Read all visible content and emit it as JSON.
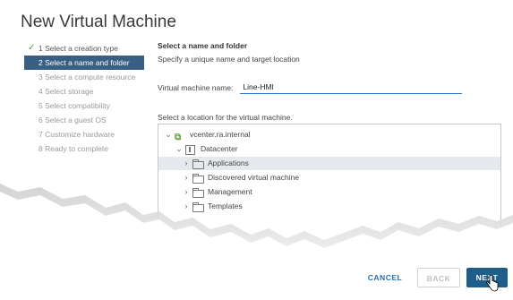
{
  "window": {
    "title": "New Virtual Machine"
  },
  "steps": [
    {
      "label": "1 Select a creation type",
      "state": "done"
    },
    {
      "label": "2 Select a name and folder",
      "state": "active"
    },
    {
      "label": "3 Select a compute resource",
      "state": "pending"
    },
    {
      "label": "4 Select storage",
      "state": "pending"
    },
    {
      "label": "5 Select compatibility",
      "state": "pending"
    },
    {
      "label": "6 Select a guest OS",
      "state": "pending"
    },
    {
      "label": "7 Customize hardware",
      "state": "pending"
    },
    {
      "label": "8 Ready to complete",
      "state": "pending"
    }
  ],
  "main": {
    "section_title": "Select a name and folder",
    "section_subtitle": "Specify a unique name and target location",
    "vm_name_label": "Virtual machine name:",
    "vm_name_value": "Line-HMI",
    "location_label": "Select a location for the virtual machine."
  },
  "tree": {
    "root": "vcenter.ra.internal",
    "datacenter": "Datacenter",
    "folders": [
      "Applications",
      "Discovered virtual machine",
      "Management",
      "Templates"
    ],
    "selected": "Applications"
  },
  "footer": {
    "cancel_label": "CANCEL",
    "back_label": "BACK",
    "next_label": "NEXT"
  },
  "colors": {
    "active_step_bg": "#3a5f84",
    "check_green": "#3f9c35",
    "input_underline": "#2a78c8",
    "next_button_bg": "#1f5d8a",
    "cancel_text": "#2a6fb3"
  }
}
